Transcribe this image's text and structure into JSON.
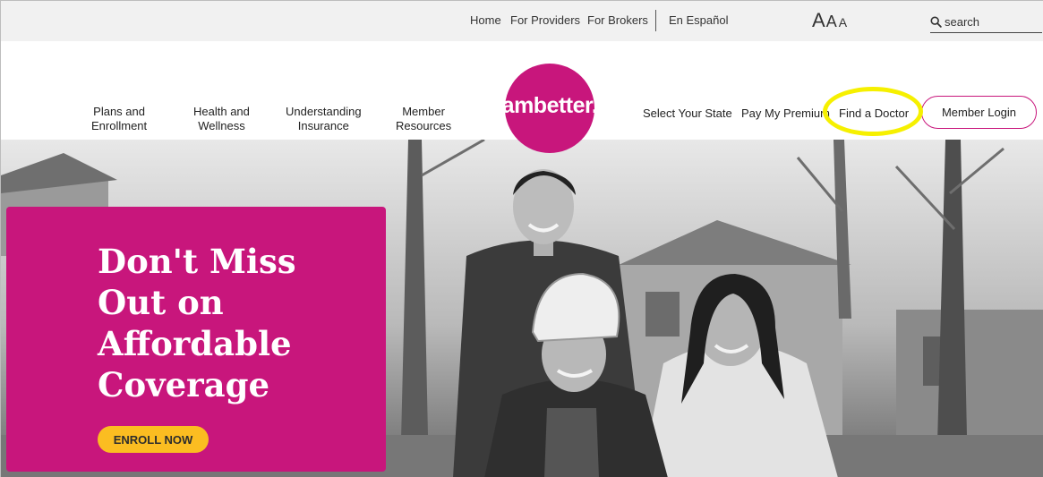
{
  "utility_nav": {
    "links": [
      "Home",
      "For Providers",
      "For Brokers",
      "En Español"
    ],
    "text_size": [
      "A",
      "A",
      "A"
    ]
  },
  "search": {
    "placeholder": "search"
  },
  "main_nav": {
    "left": [
      "Plans and\nEnrollment",
      "Health and\nWellness",
      "Understanding\nInsurance",
      "Member\nResources"
    ],
    "logo": "ambetter.",
    "right": [
      "Select Your State",
      "Pay My Premium",
      "Find a Doctor"
    ],
    "login": "Member Login"
  },
  "hero": {
    "title": "Don't Miss Out on Affordable Coverage",
    "cta": "ENROLL NOW"
  },
  "colors": {
    "brand_magenta": "#c8167c",
    "cta_yellow": "#fbbd21",
    "highlight": "#f6f000"
  }
}
